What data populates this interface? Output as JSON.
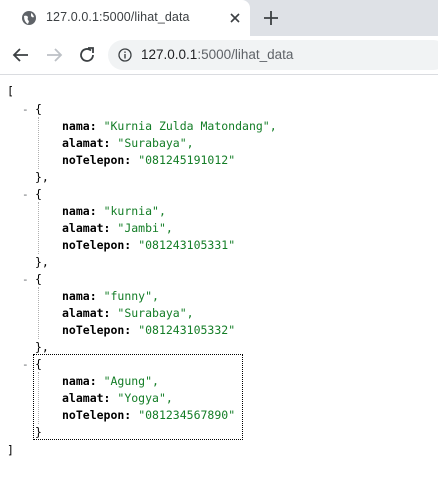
{
  "browser": {
    "tab_title": "127.0.0.1:5000/lihat_data",
    "url_host": "127.0.0.1",
    "url_path": ":5000/lihat_data"
  },
  "json_view": {
    "open_bracket": "[",
    "close_bracket": "]",
    "toggle_symbol": "-",
    "open_brace": "{",
    "close_brace": "},",
    "last_close_brace": "}",
    "items": [
      {
        "nama": "\"Kurnia Zulda Matondang\",",
        "alamat": "\"Surabaya\",",
        "noTelepon": "\"081245191012\""
      },
      {
        "nama": "\"kurnia\",",
        "alamat": "\"Jambi\",",
        "noTelepon": "\"081243105331\""
      },
      {
        "nama": "\"funny\",",
        "alamat": "\"Surabaya\",",
        "noTelepon": "\"081243105332\""
      },
      {
        "nama": "\"Agung\",",
        "alamat": "\"Yogya\",",
        "noTelepon": "\"081234567890\""
      }
    ],
    "key_labels": {
      "nama": "nama:",
      "alamat": "alamat:",
      "noTelepon": "noTelepon:"
    }
  },
  "colors": {
    "string": "#137d26",
    "tabstrip": "#dee1e6",
    "omnibox": "#f1f3f4"
  }
}
